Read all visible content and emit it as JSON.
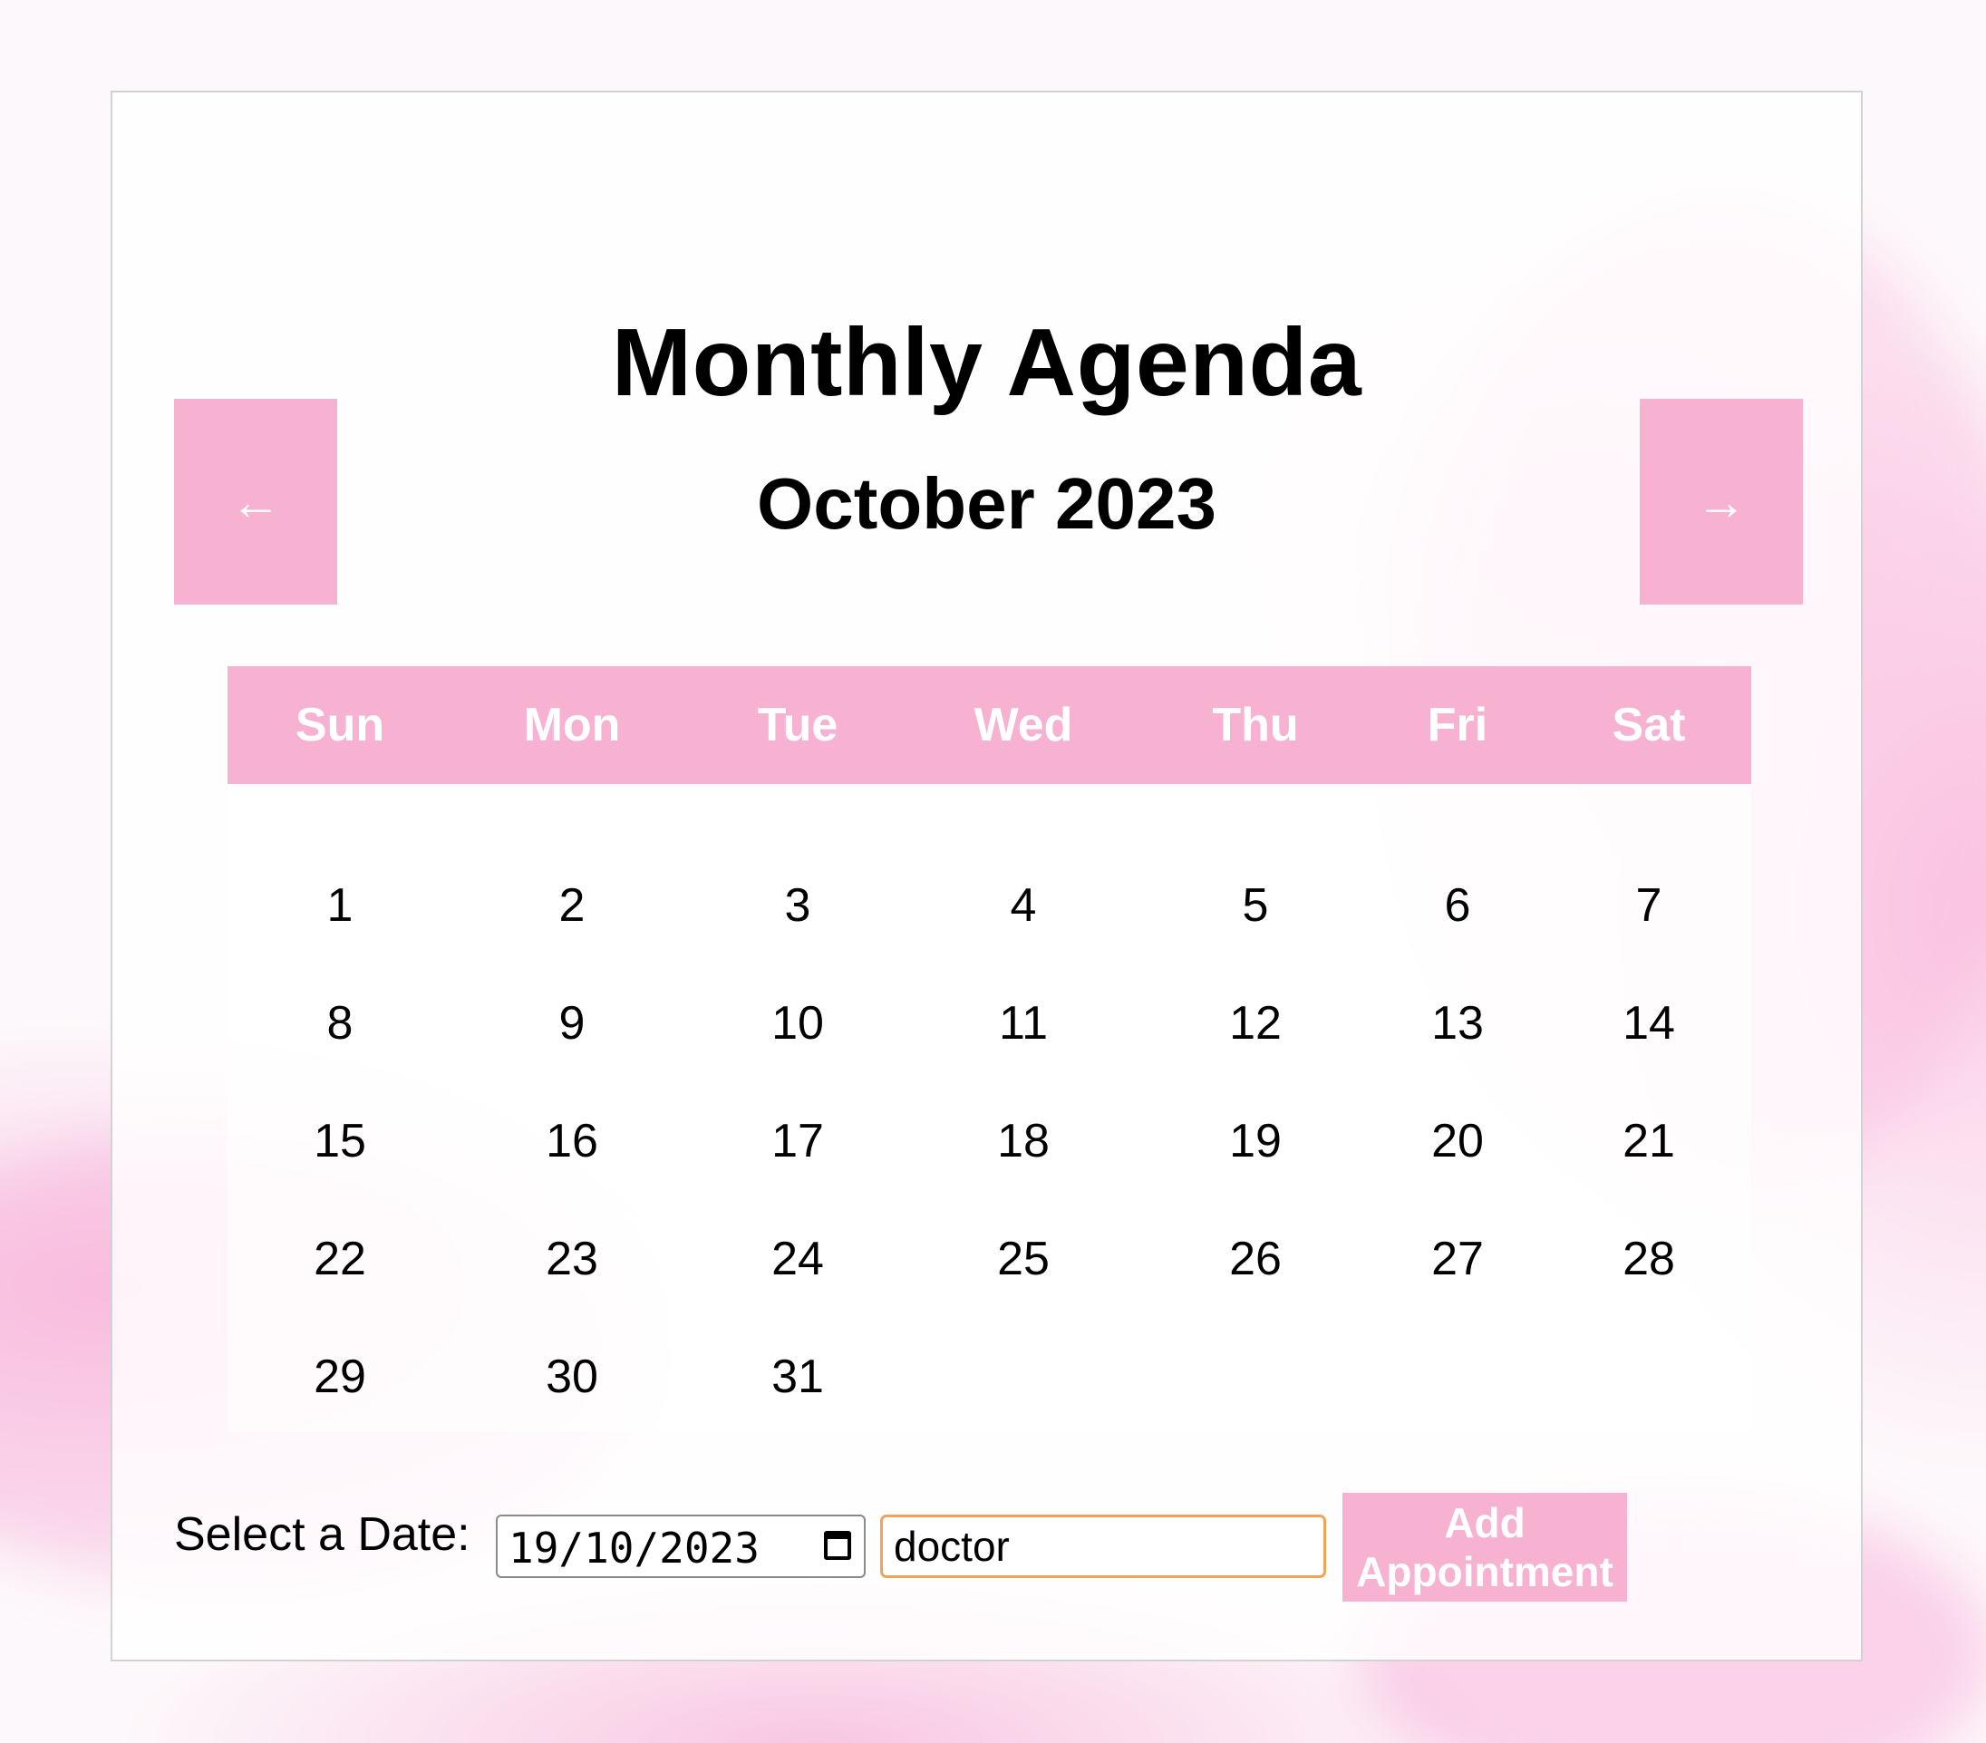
{
  "page": {
    "title": "Monthly Agenda"
  },
  "nav": {
    "prev_icon": "←",
    "next_icon": "→",
    "month_label": "October 2023"
  },
  "calendar": {
    "weekdays": [
      "Sun",
      "Mon",
      "Tue",
      "Wed",
      "Thu",
      "Fri",
      "Sat"
    ],
    "weeks": [
      [
        "1",
        "2",
        "3",
        "4",
        "5",
        "6",
        "7"
      ],
      [
        "8",
        "9",
        "10",
        "11",
        "12",
        "13",
        "14"
      ],
      [
        "15",
        "16",
        "17",
        "18",
        "19",
        "20",
        "21"
      ],
      [
        "22",
        "23",
        "24",
        "25",
        "26",
        "27",
        "28"
      ],
      [
        "29",
        "30",
        "31",
        "",
        "",
        "",
        ""
      ]
    ]
  },
  "form": {
    "date_label": "Select a Date:",
    "date_value": "19/10/2023",
    "calendar_icon": "calendar-icon",
    "text_value": "doctor",
    "add_button_label": "Add Appointment"
  },
  "colors": {
    "accent": "#f7b2d2",
    "input_focus": "#f2a35a",
    "text": "#000000",
    "on_accent": "#ffffff"
  }
}
